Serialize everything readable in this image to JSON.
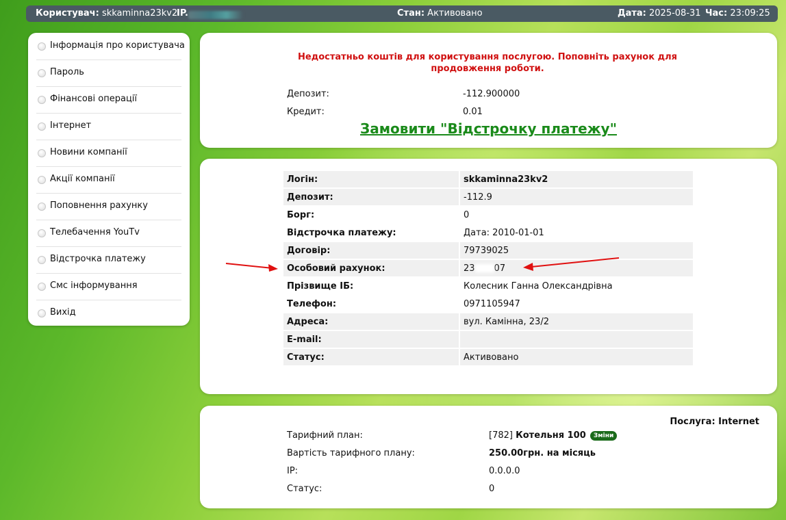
{
  "topbar": {
    "user_label": "Користувач:",
    "user_value": "skkaminna23kv2",
    "ip_label": "IP.",
    "state_label": "Стан:",
    "state_value": "Активовано",
    "date_label": "Дата:",
    "date_value": "2025-08-31",
    "time_label": "Час:",
    "time_value": "23:09:25"
  },
  "menu": [
    {
      "label": "Інформація про користувача",
      "icon": "radio-icon"
    },
    {
      "label": "Пароль",
      "icon": "radio-icon"
    },
    {
      "label": "Фінансові операції",
      "icon": "radio-icon"
    },
    {
      "label": "Інтернет",
      "icon": "radio-icon"
    },
    {
      "label": "Новини компанії",
      "icon": "radio-icon"
    },
    {
      "label": "Акції компанії",
      "icon": "radio-icon"
    },
    {
      "label": "Поповнення рахунку",
      "icon": "radio-icon"
    },
    {
      "label": "Телебачення YouTv",
      "icon": "radio-icon"
    },
    {
      "label": "Відстрочка платежу",
      "icon": "radio-icon"
    },
    {
      "label": "Смс інформування",
      "icon": "radio-icon"
    },
    {
      "label": "Вихід",
      "icon": "radio-icon"
    }
  ],
  "warning": {
    "text": "Недостатньо коштів для користування послугою. Поповніть рахунок для продовження роботи.",
    "deposit_label": "Депозит:",
    "deposit_value": "-112.900000",
    "credit_label": "Кредит:",
    "credit_value": "0.01",
    "order_link": "Замовити \"Відстрочку платежу\""
  },
  "user_info": {
    "rows": [
      {
        "label": "Логін:",
        "value": "skkaminna23kv2"
      },
      {
        "label": "Депозит:",
        "value": "-112.9"
      },
      {
        "label": "Борг:",
        "value": "0"
      },
      {
        "label": "Відстрочка платежу:",
        "value": "Дата: 2010-01-01"
      },
      {
        "label": "Договір:",
        "value": "79739025"
      },
      {
        "label": "Особовий рахунок:",
        "value_prefix": "23",
        "value_suffix": "07"
      },
      {
        "label": "Прізвище ІБ:",
        "value": "Колесник Ганна Олександрівна"
      },
      {
        "label": "Телефон:",
        "value": "0971105947"
      },
      {
        "label": "Адреса:",
        "value": "вул. Камінна, 23/2"
      },
      {
        "label": "E-mail:",
        "value": ""
      },
      {
        "label": "Статус:",
        "value": "Активовано"
      }
    ]
  },
  "service": {
    "title": "Послуга: Internet",
    "plan_label": "Тарифний план:",
    "plan_code": "[782]",
    "plan_name": "Котельня 100",
    "change_badge": "Зміни",
    "price_label": "Вартість тарифного плану:",
    "price_value": "250.00грн. на місяць",
    "ip_label": "IP:",
    "ip_value": "0.0.0.0",
    "status_label": "Статус:",
    "status_value": "0"
  },
  "colors": {
    "warning": "#d01010",
    "link": "#1a8a1a",
    "topbar": "#4a5a63",
    "badge": "#1b6b1b",
    "arrow": "#e01010"
  }
}
